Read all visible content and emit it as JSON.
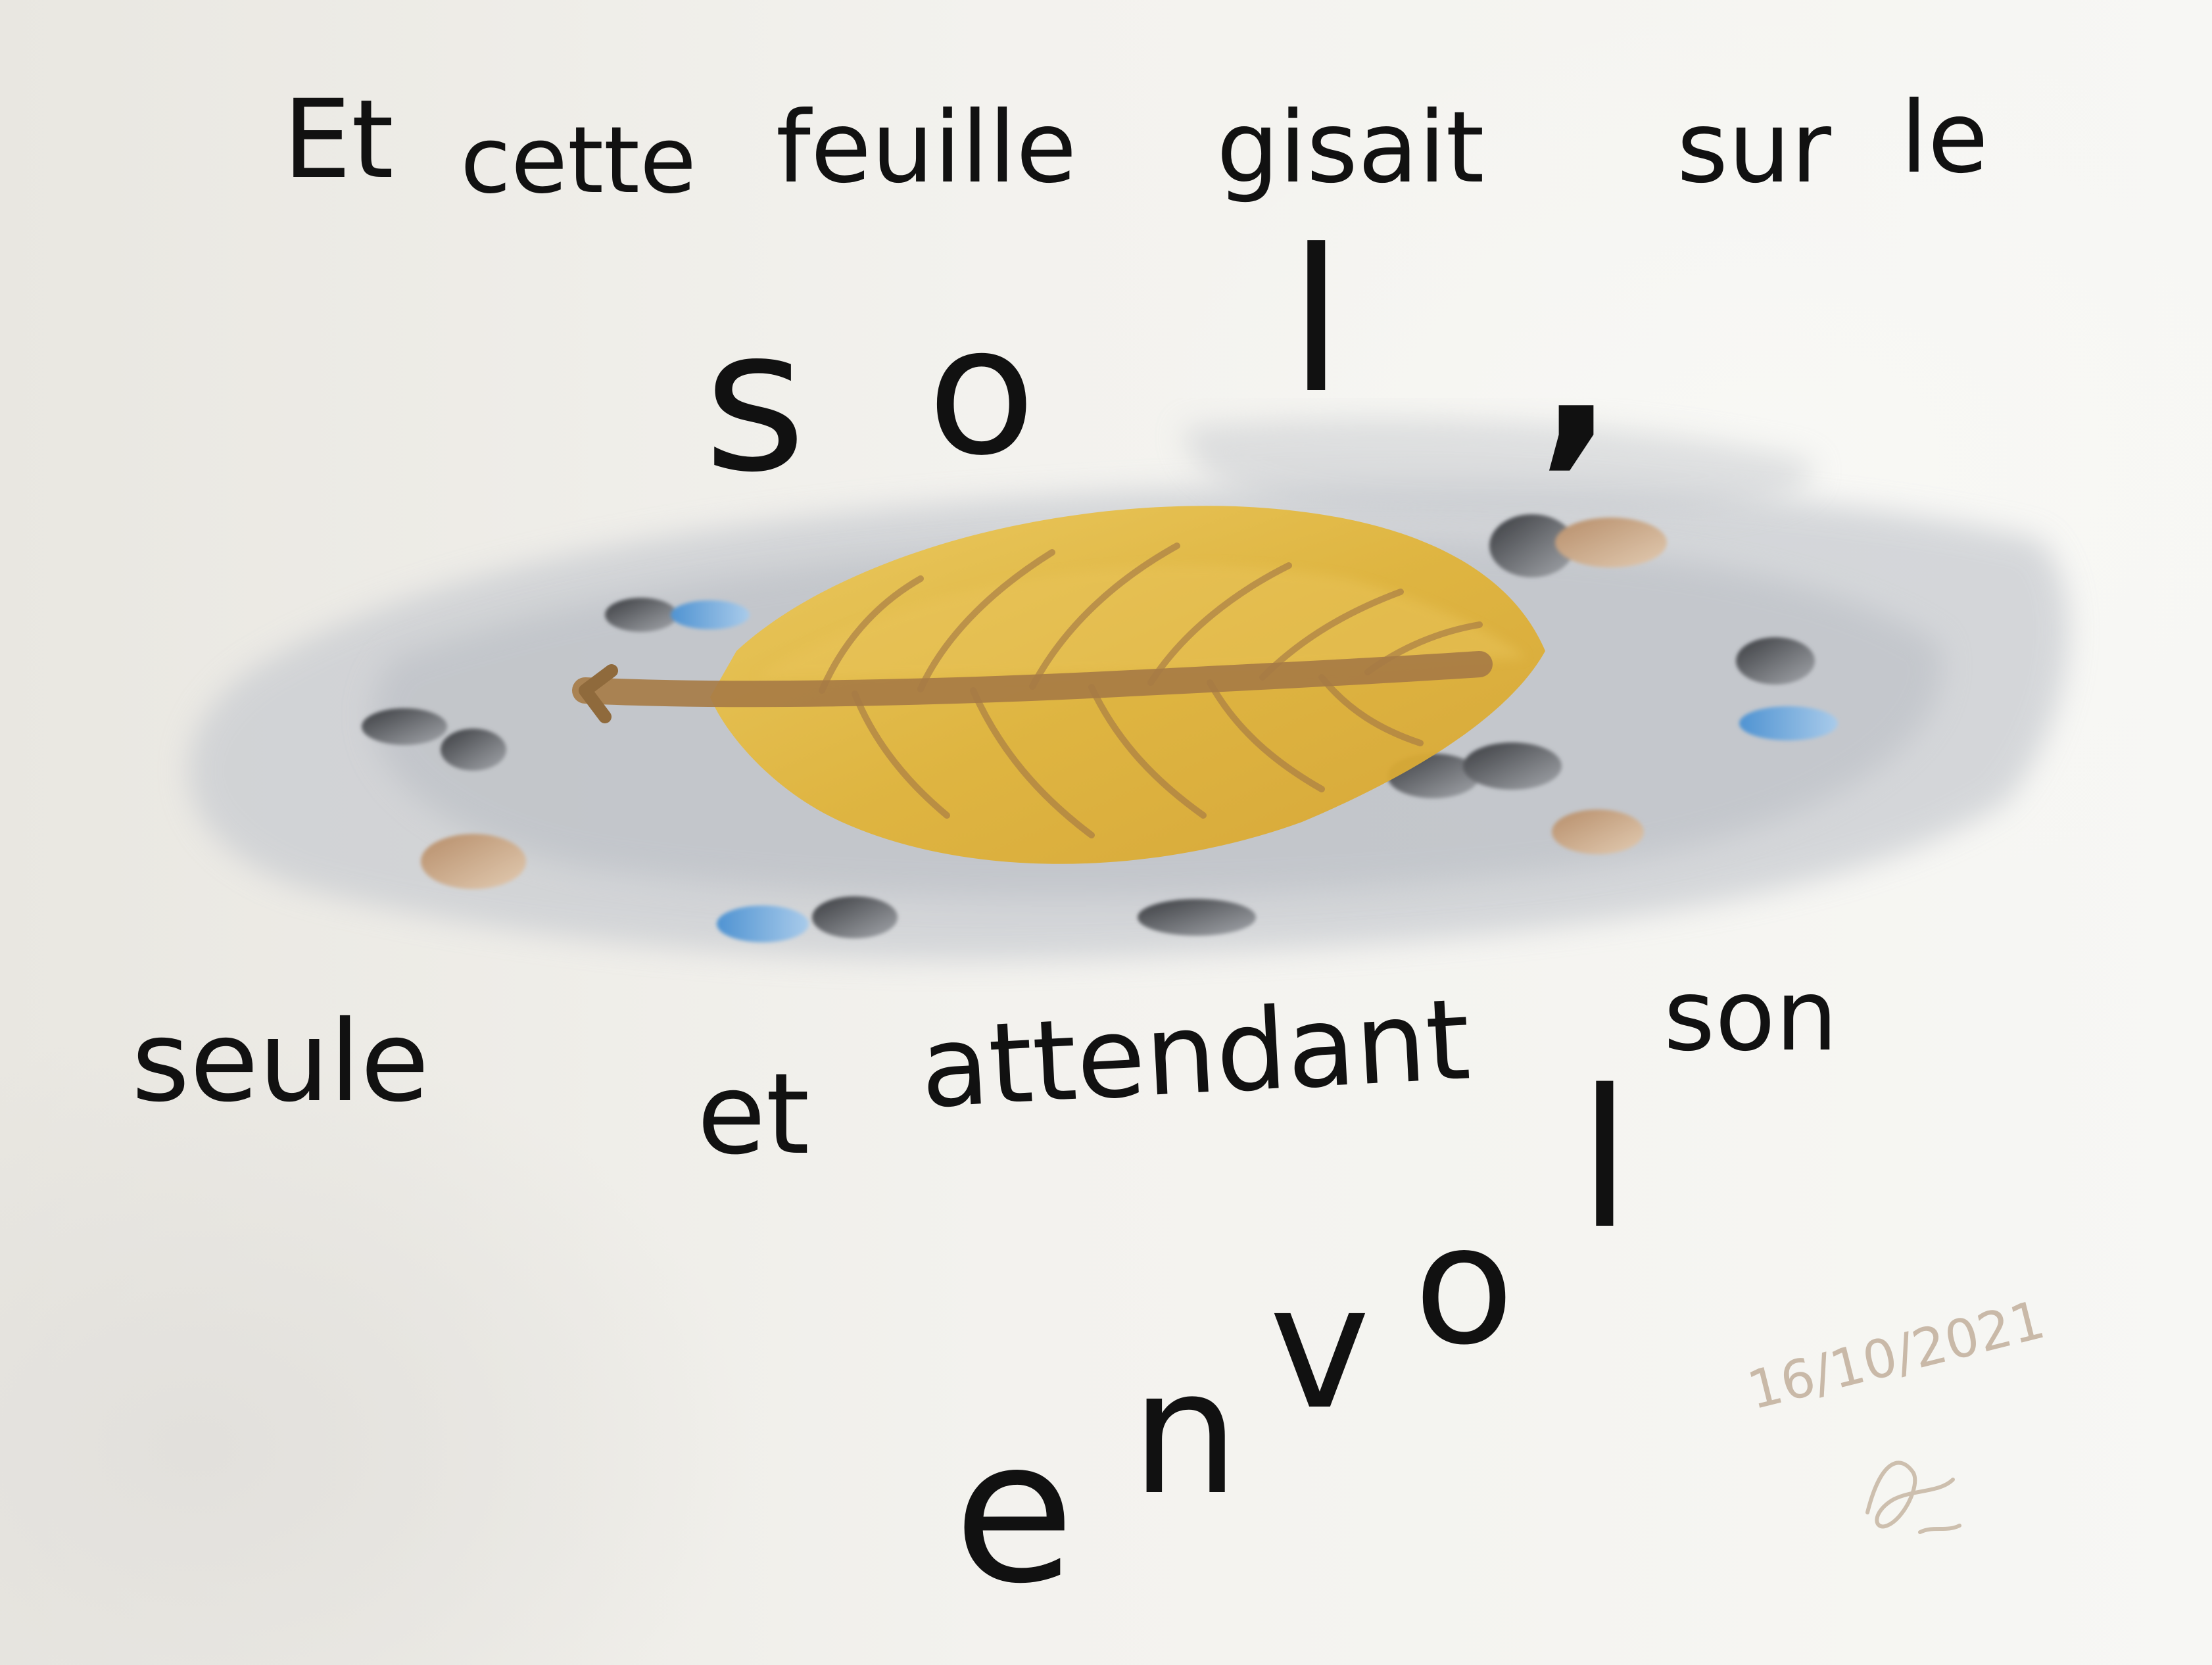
{
  "poem": {
    "line1": {
      "w1": "Et",
      "w2": "cette",
      "w3": "feuille",
      "w4": "gisait",
      "w5": "sur",
      "w6": "le"
    },
    "line2": {
      "l1": "s",
      "l2": "o",
      "l3": "l",
      "l4": ","
    },
    "line3": {
      "w1": "seule",
      "w2": "et",
      "w3": "attendant",
      "w4": "son"
    },
    "line4": {
      "l1": "e",
      "l2": "n",
      "l3": "v",
      "l4": "o",
      "l5": "l"
    }
  },
  "signature": {
    "date": "16/10/2021"
  },
  "colors": {
    "ink": "#111111",
    "leaf": "#e0b43a",
    "leaf_vein": "#a67a45",
    "stone_gray": "#7d8086",
    "stone_blue": "#6aa6d8",
    "stone_tan": "#c4a484",
    "ground_wash": "#c9ccd1",
    "paper": "#f3f2ee"
  },
  "illustration": {
    "subject": "leaf-icon",
    "ground": "watercolor-wash-icon",
    "stones": "pebble-icon"
  }
}
